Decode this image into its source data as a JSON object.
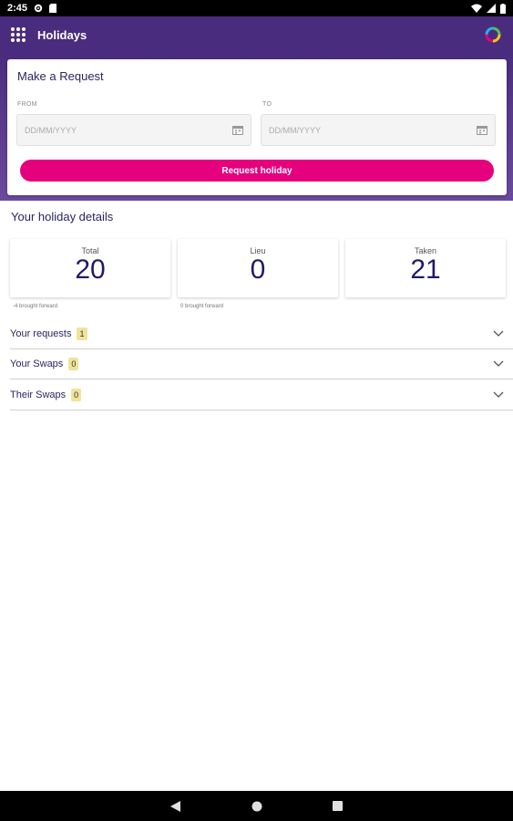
{
  "status_bar": {
    "time": "2:45"
  },
  "app_bar": {
    "title": "Holidays",
    "menu_icon": "grid-menu-icon",
    "brand_icon": "ring-logo-icon"
  },
  "request": {
    "title": "Make a Request",
    "from_label": "FROM",
    "to_label": "TO",
    "from_placeholder": "DD/MM/YYYY",
    "to_placeholder": "DD/MM/YYYY",
    "button_label": "Request holiday",
    "button_color": "#e5007d"
  },
  "details": {
    "title": "Your holiday details",
    "stats": [
      {
        "label": "Total",
        "value": "20",
        "note": "-4 brought forward"
      },
      {
        "label": "Lieu",
        "value": "0",
        "note": "0 brought forward"
      },
      {
        "label": "Taken",
        "value": "21",
        "note": ""
      }
    ]
  },
  "sections": [
    {
      "label": "Your requests",
      "count": "1"
    },
    {
      "label": "Your Swaps",
      "count": "0"
    },
    {
      "label": "Their Swaps",
      "count": "0"
    }
  ],
  "colors": {
    "primary": "#4a2c7e",
    "accent": "#e5007d",
    "text": "#2a2560",
    "badge": "#f0e39a"
  }
}
